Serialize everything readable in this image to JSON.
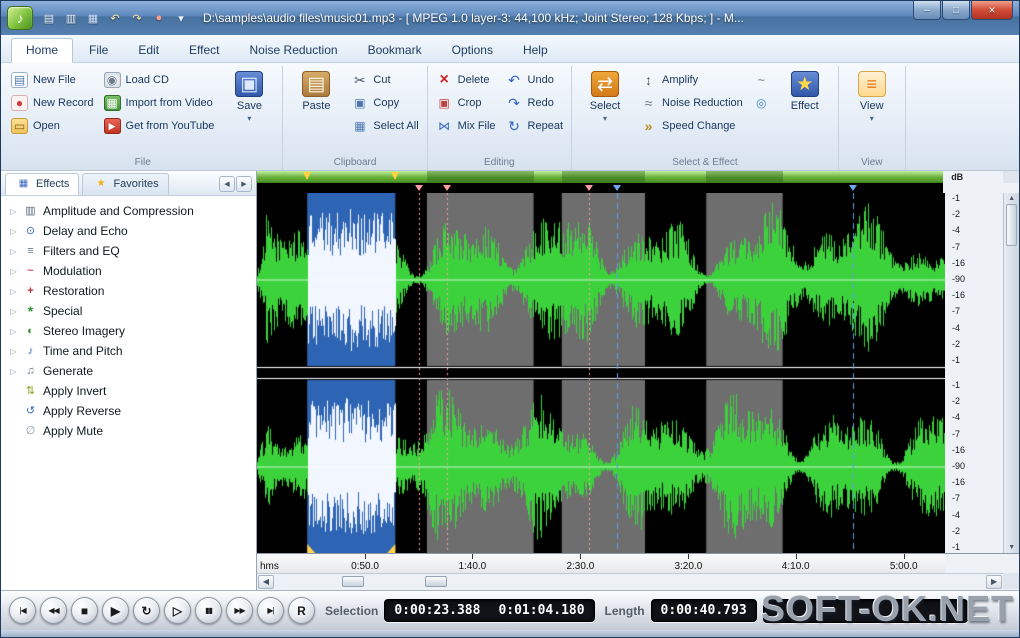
{
  "window": {
    "title": "D:\\samples\\audio files\\music01.mp3 - [ MPEG 1.0 layer-3: 44,100 kHz; Joint Stereo; 128 Kbps;  ] - M...",
    "minimize_glyph": "–",
    "maximize_glyph": "□",
    "close_glyph": "×"
  },
  "quick_access": [
    {
      "name": "import-file",
      "glyph": "▤",
      "color": "#eaf2fc"
    },
    {
      "name": "export-file",
      "glyph": "▥",
      "color": "#eaf2fc"
    },
    {
      "name": "quick-save",
      "glyph": "▦",
      "color": "#cfe2ff"
    },
    {
      "name": "quick-undo",
      "glyph": "↶",
      "color": "#ffe9a8"
    },
    {
      "name": "quick-redo",
      "glyph": "↷",
      "color": "#ffe9a8"
    },
    {
      "name": "quick-record",
      "glyph": "●",
      "color": "#ff9a8a"
    },
    {
      "name": "customize-toolbar",
      "glyph": "▾",
      "color": "#eaf2fc"
    }
  ],
  "menu": {
    "tabs": [
      "Home",
      "File",
      "Edit",
      "Effect",
      "Noise Reduction",
      "Bookmark",
      "Options",
      "Help"
    ],
    "active_index": 0
  },
  "ribbon": {
    "groups": [
      {
        "label": "File",
        "items": [
          {
            "name": "new-file",
            "label": "New File",
            "icon": "new-file",
            "col": 1
          },
          {
            "name": "new-record",
            "label": "New Record",
            "icon": "new-record",
            "col": 1
          },
          {
            "name": "open",
            "label": "Open",
            "icon": "open",
            "col": 1
          },
          {
            "name": "load-cd",
            "label": "Load CD",
            "icon": "load-cd",
            "col": 2
          },
          {
            "name": "import-from-video",
            "label": "Import from Video",
            "icon": "import-video",
            "col": 2
          },
          {
            "name": "get-from-youtube",
            "label": "Get from YouTube",
            "icon": "youtube",
            "col": 2
          },
          {
            "name": "save",
            "label": "Save",
            "icon": "save",
            "big": true,
            "dropdown": true
          }
        ]
      },
      {
        "label": "Clipboard",
        "items": [
          {
            "name": "paste",
            "label": "Paste",
            "icon": "paste",
            "big": true
          },
          {
            "name": "cut",
            "label": "Cut",
            "icon": "cut",
            "col": 1
          },
          {
            "name": "copy",
            "label": "Copy",
            "icon": "copy",
            "col": 1
          },
          {
            "name": "select-all",
            "label": "Select All",
            "icon": "select-all",
            "col": 1
          }
        ]
      },
      {
        "label": "Editing",
        "items": [
          {
            "name": "delete",
            "label": "Delete",
            "icon": "delete",
            "col": 1
          },
          {
            "name": "crop",
            "label": "Crop",
            "icon": "crop",
            "col": 1
          },
          {
            "name": "mix-file",
            "label": "Mix File",
            "icon": "mix-file",
            "col": 1
          },
          {
            "name": "undo",
            "label": "Undo",
            "icon": "undo",
            "col": 2
          },
          {
            "name": "redo",
            "label": "Redo",
            "icon": "redo",
            "col": 2
          },
          {
            "name": "repeat",
            "label": "Repeat",
            "icon": "repeat",
            "col": 2
          }
        ]
      },
      {
        "label": "Select & Effect",
        "items": [
          {
            "name": "select",
            "label": "Select",
            "icon": "select",
            "big": true,
            "dropdown": true
          },
          {
            "name": "amplify",
            "label": "Amplify",
            "icon": "amplify",
            "col": 1
          },
          {
            "name": "noise-reduction",
            "label": "Noise Reduction",
            "icon": "noise-reduction",
            "col": 1
          },
          {
            "name": "speed-change",
            "label": "Speed Change",
            "icon": "speed-change",
            "col": 1
          },
          {
            "name": "effect-extra-1",
            "label": "",
            "icon": "effect-extra-1",
            "col": 2
          },
          {
            "name": "effect-extra-2",
            "label": "",
            "icon": "effect-extra-2",
            "col": 2
          },
          {
            "name": "effect",
            "label": "Effect",
            "icon": "effect",
            "big": true
          }
        ]
      },
      {
        "label": "View",
        "items": [
          {
            "name": "view",
            "label": "View",
            "icon": "view",
            "big": true,
            "dropdown": true
          }
        ]
      }
    ]
  },
  "sidebar": {
    "tabs": [
      {
        "label": "Effects",
        "icon": "effects-tab",
        "active": true
      },
      {
        "label": "Favorites",
        "icon": "favorites-tab",
        "active": false
      }
    ],
    "items": [
      {
        "label": "Amplitude and Compression",
        "icon": "amplitude",
        "expandable": true
      },
      {
        "label": "Delay and Echo",
        "icon": "delay",
        "expandable": true
      },
      {
        "label": "Filters and EQ",
        "icon": "filters",
        "expandable": true
      },
      {
        "label": "Modulation",
        "icon": "modulation",
        "expandable": true
      },
      {
        "label": "Restoration",
        "icon": "restoration",
        "expandable": true
      },
      {
        "label": "Special",
        "icon": "special",
        "expandable": true
      },
      {
        "label": "Stereo Imagery",
        "icon": "stereo",
        "expandable": true
      },
      {
        "label": "Time and Pitch",
        "icon": "time-pitch",
        "expandable": true
      },
      {
        "label": "Generate",
        "icon": "generate",
        "expandable": true
      },
      {
        "label": "Apply Invert",
        "icon": "invert",
        "expandable": false
      },
      {
        "label": "Apply Reverse",
        "icon": "reverse",
        "expandable": false
      },
      {
        "label": "Apply Mute",
        "icon": "mute",
        "expandable": false
      }
    ]
  },
  "waveform": {
    "db_label": "dB",
    "db_scale": [
      "-1",
      "-2",
      "-4",
      "-7",
      "-16",
      "-90",
      "-16",
      "-7",
      "-4",
      "-2",
      "-1"
    ],
    "selection": {
      "start_frac": 0.073,
      "end_frac": 0.201
    },
    "grey_regions": [
      [
        0.247,
        0.402
      ],
      [
        0.443,
        0.564
      ],
      [
        0.653,
        0.764
      ]
    ],
    "markers_pink": [
      0.236,
      0.276,
      0.483
    ],
    "markers_blue": [
      0.523,
      0.867
    ],
    "timeline": {
      "unit_label": "hms",
      "ticks": [
        {
          "label": "0:50.0",
          "frac": 0.157
        },
        {
          "label": "1:40.0",
          "frac": 0.313
        },
        {
          "label": "2:30.0",
          "frac": 0.47
        },
        {
          "label": "3:20.0",
          "frac": 0.627
        },
        {
          "label": "4:10.0",
          "frac": 0.783
        },
        {
          "label": "5:00.0",
          "frac": 0.94
        }
      ]
    }
  },
  "transport": {
    "buttons": [
      {
        "name": "go-to-start",
        "glyph": "|◀"
      },
      {
        "name": "rewind",
        "glyph": "◀◀"
      },
      {
        "name": "stop",
        "glyph": "■",
        "big": true
      },
      {
        "name": "play",
        "glyph": "▶",
        "big": true
      },
      {
        "name": "loop-play",
        "glyph": "↻",
        "big": true
      },
      {
        "name": "play-from-cursor",
        "glyph": "▷",
        "big": true
      },
      {
        "name": "pause",
        "glyph": "▮▮"
      },
      {
        "name": "fast-forward",
        "glyph": "▶▶"
      },
      {
        "name": "go-to-end",
        "glyph": "▶|"
      },
      {
        "name": "record-mode",
        "glyph": "R",
        "big": true
      }
    ],
    "selection_label": "Selection",
    "selection_start": "0:00:23.388",
    "selection_end": "0:01:04.180",
    "length_label": "Length",
    "length_value": "0:00:40.793"
  },
  "watermark": "SOFT-OK.NET",
  "colors": {
    "wave_green": "#3bd23c",
    "selection_blue": "#2d64b4",
    "grey_region": "#6e6e6e",
    "marker_pink": "#ff9d9d",
    "marker_blue": "#5f9ce6"
  },
  "icons": {
    "new-file": {
      "g": "▤",
      "fg": "#4a78b0",
      "bg": "#ffffff",
      "bd": "#9ab0c8"
    },
    "new-record": {
      "g": "●",
      "fg": "#d03a3a",
      "bg": "#fdf3f3",
      "bd": "#d8b0b0"
    },
    "open": {
      "g": "▭",
      "fg": "#8a6414",
      "bg": "linear-gradient(#ffe49a,#edbf5a)",
      "bd": "#c89c3c"
    },
    "load-cd": {
      "g": "◉",
      "fg": "#6a7a8a",
      "bg": "radial-gradient(#ffffff,#c9d2da)",
      "bd": "#9aa8b5"
    },
    "import-video": {
      "g": "▦",
      "fg": "#ffffff",
      "bg": "linear-gradient(#7cc36a,#3f8f35)",
      "bd": "#2f6f28"
    },
    "youtube": {
      "g": "▶",
      "fg": "#ffffff",
      "bg": "linear-gradient(#e86a5a,#c03020)",
      "bd": "#992618",
      "fs": 9
    },
    "save": {
      "g": "▣",
      "fg": "#dce8ff",
      "bg": "linear-gradient(#6a8fd8,#2f55a8)",
      "bd": "#24427f"
    },
    "paste": {
      "g": "▤",
      "fg": "#fdf6e3",
      "bg": "linear-gradient(#d8ad6a,#a8783a)",
      "bd": "#8a6030"
    },
    "cut": {
      "g": "✂",
      "fg": "#4a5a6a",
      "fs": 14
    },
    "copy": {
      "g": "▣",
      "fg": "#4a78b0"
    },
    "select-all": {
      "g": "▦",
      "fg": "#4a78b0"
    },
    "delete": {
      "g": "×",
      "fg": "#d02020",
      "fs": 16,
      "b": true
    },
    "crop": {
      "g": "▣",
      "fg": "#c04040"
    },
    "mix-file": {
      "g": "⋈",
      "fg": "#3a6ac0"
    },
    "undo": {
      "g": "↶",
      "fg": "#2f62c8",
      "fs": 14
    },
    "redo": {
      "g": "↷",
      "fg": "#2f62c8",
      "fs": 14
    },
    "repeat": {
      "g": "↻",
      "fg": "#2f62c8",
      "fs": 14
    },
    "select": {
      "g": "⇄",
      "fg": "#ffffff",
      "bg": "linear-gradient(#f0a83a,#d07818)",
      "bd": "#a85c10"
    },
    "amplify": {
      "g": "↕",
      "fg": "#4a5a6a",
      "fs": 14
    },
    "noise-reduction": {
      "g": "≈",
      "fg": "#6a7a8a",
      "fs": 14
    },
    "speed-change": {
      "g": "»",
      "fg": "#c08a18",
      "fs": 14,
      "b": true
    },
    "effect-extra-1": {
      "g": "~",
      "fg": "#8a98a8",
      "b": true
    },
    "effect-extra-2": {
      "g": "◎",
      "fg": "#3a8ad0"
    },
    "effect": {
      "g": "★",
      "fg": "#ffd84a",
      "bg": "linear-gradient(#6a8fd8,#2f55a8)",
      "bd": "#24427f"
    },
    "view": {
      "g": "≡",
      "fg": "#e07818",
      "bg": "linear-gradient(#fff2d8,#ffd88a)",
      "bd": "#d8a848",
      "fs": 18
    },
    "effects-tab": {
      "g": "▦",
      "fg": "#3a6ac0",
      "fs": 10
    },
    "favorites-tab": {
      "g": "★",
      "fg": "#f0b018",
      "fs": 10
    },
    "amplitude": {
      "g": "▥",
      "fg": "#5a6a7a"
    },
    "delay": {
      "g": "⊙",
      "fg": "#3a6ac0"
    },
    "filters": {
      "g": "≡",
      "fg": "#6a7a8a"
    },
    "modulation": {
      "g": "~",
      "fg": "#c04878",
      "b": true
    },
    "restoration": {
      "g": "+",
      "fg": "#c03030",
      "b": true
    },
    "special": {
      "g": "*",
      "fg": "#2f8f2f",
      "b": true,
      "fs": 14
    },
    "stereo": {
      "g": "◐",
      "fg": "#2f8f2f"
    },
    "time-pitch": {
      "g": "♪",
      "fg": "#3a6ac0"
    },
    "generate": {
      "g": "♫",
      "fg": "#6a7a8a"
    },
    "invert": {
      "g": "⇅",
      "fg": "#8aa018"
    },
    "reverse": {
      "g": "↺",
      "fg": "#3a6ac0"
    },
    "mute": {
      "g": "∅",
      "fg": "#8a98a8"
    }
  }
}
